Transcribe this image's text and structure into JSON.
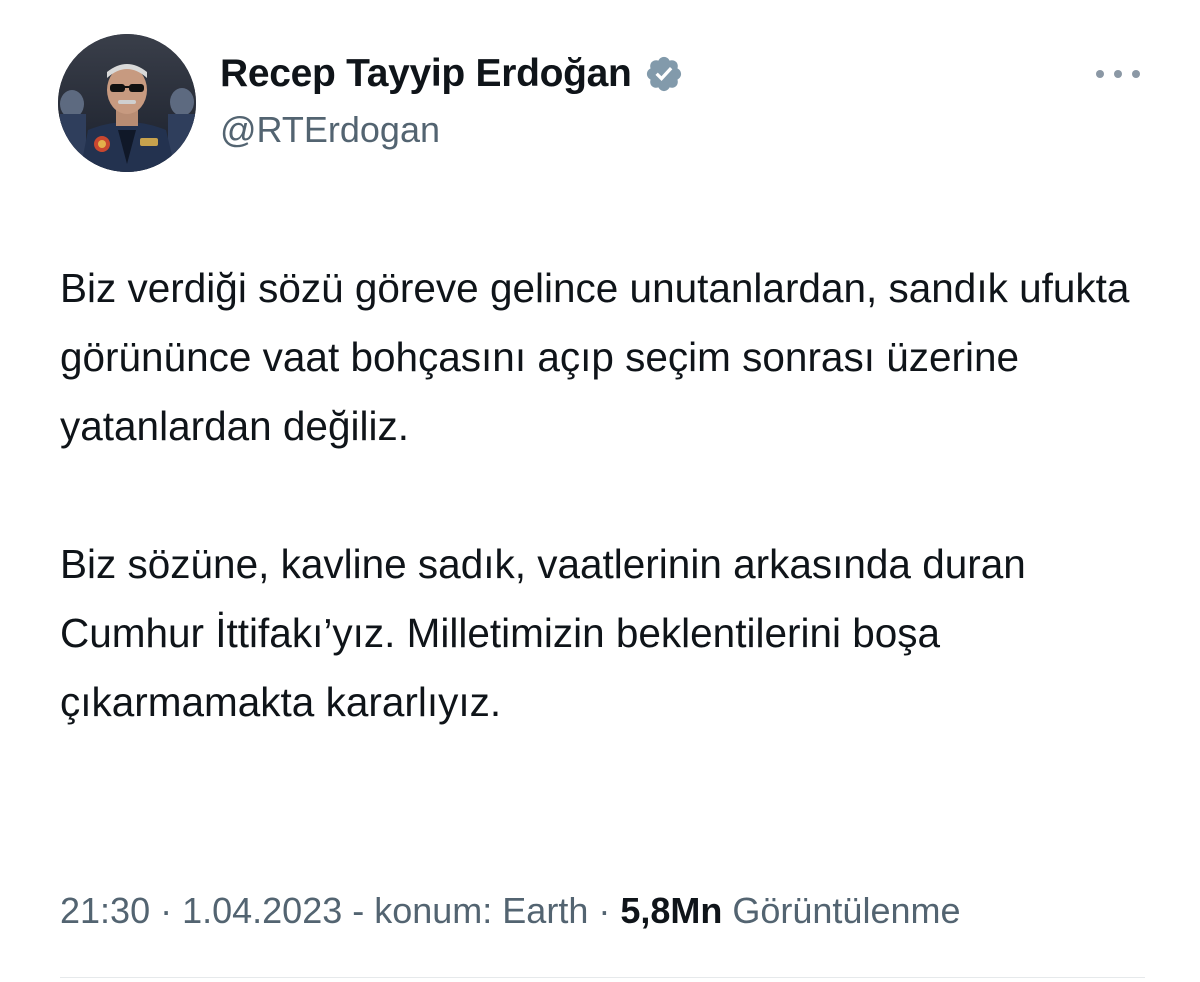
{
  "author": {
    "display_name": "Recep Tayyip Erdoğan",
    "handle": "@RTErdogan",
    "verified_icon": "verified-badge-icon",
    "avatar_icon": "profile-photo"
  },
  "more_icon": "more-options-icon",
  "tweet": {
    "paragraph_1": "Biz verdiği sözü göreve gelince unutanlardan, sandık ufukta görününce vaat bohçasını açıp seçim sonrası üzerine yatanlardan değiliz.",
    "paragraph_2": "Biz sözüne, kavline sadık, vaatlerinin arkasında duran Cumhur İttifakı’yız. Milletimizin beklentilerini boşa çıkarmamakta kararlıyız."
  },
  "meta": {
    "time": "21:30",
    "separator_1": " · ",
    "date": "1.04.2023",
    "location": " - konum: Earth",
    "separator_2": " · ",
    "views_count": "5,8Mn",
    "views_label": " Görüntülenme"
  },
  "colors": {
    "text_primary": "#0f1419",
    "text_secondary": "#536471",
    "badge": "#829aab",
    "divider": "#e6e9eb"
  }
}
